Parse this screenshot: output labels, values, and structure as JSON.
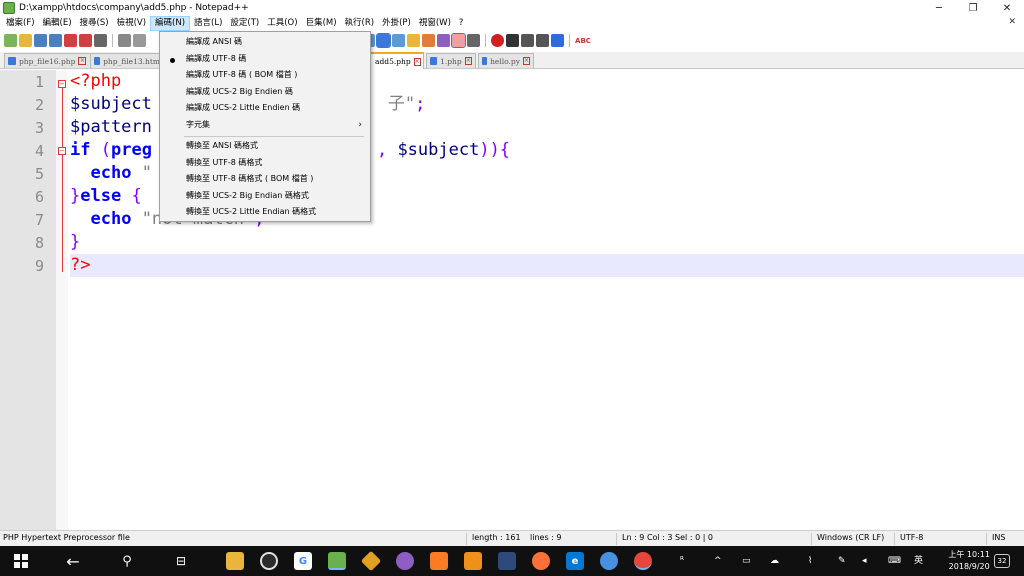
{
  "window": {
    "title": "D:\\xampp\\htdocs\\company\\add5.php - Notepad++",
    "minimize_glyph": "─",
    "maximize_glyph": "❐",
    "close_glyph": "✕"
  },
  "menubar": {
    "items": [
      "檔案(F)",
      "編輯(E)",
      "搜尋(S)",
      "檢視(V)",
      "編碼(N)",
      "語言(L)",
      "設定(T)",
      "工具(O)",
      "巨集(M)",
      "執行(R)",
      "外掛(P)",
      "視窗(W)",
      "?"
    ],
    "active_index": 4,
    "close_glyph": "✕"
  },
  "tabs": [
    {
      "label": "php_file16.php",
      "active": false
    },
    {
      "label": "php_file13.htm",
      "active": false
    },
    {
      "label": "add5.php",
      "active": true
    },
    {
      "label": "1.php",
      "active": false
    },
    {
      "label": "hello.py",
      "active": false
    }
  ],
  "editor": {
    "line_numbers": [
      "1",
      "2",
      "3",
      "4",
      "5",
      "6",
      "7",
      "8",
      "9"
    ],
    "current_line": 9,
    "fold_minus": "−"
  },
  "encoding_menu": {
    "items": [
      {
        "label": "編譯成 ANSI 碼",
        "checked": false
      },
      {
        "label": "編譯成 UTF-8 碼",
        "checked": true
      },
      {
        "label": "編譯成 UTF-8 碼 ( BOM 檔首 )",
        "checked": false
      },
      {
        "label": "編譯成 UCS-2 Big Endien 碼",
        "checked": false
      },
      {
        "label": "編譯成 UCS-2 Little Endien 碼",
        "checked": false
      },
      {
        "label": "字元集",
        "checked": false,
        "submenu": true
      },
      {
        "label": "轉換至 ANSI 碼格式",
        "checked": false
      },
      {
        "label": "轉換至 UTF-8 碼格式",
        "checked": false
      },
      {
        "label": "轉換至 UTF-8 碼格式 ( BOM 檔首 )",
        "checked": false
      },
      {
        "label": "轉換至 UCS-2 Big Endian 碼格式",
        "checked": false
      },
      {
        "label": "轉換至 UCS-2 Little Endian 碼格式",
        "checked": false
      }
    ],
    "submenu_arrow": "›"
  },
  "statusbar": {
    "language": "PHP Hypertext Preprocessor file",
    "length": "length : 161",
    "lines": "lines : 9",
    "position": "Ln : 9   Col : 3   Sel : 0 | 0",
    "eol": "Windows (CR LF)",
    "encoding": "UTF-8",
    "mode": "INS"
  },
  "taskbar": {
    "ime": "英",
    "time": "上午 10:11",
    "date": "2018/9/20",
    "notification_count": "32"
  },
  "colors": {
    "accent": "#f5a623",
    "menu_highlight": "#cce8ff",
    "current_line": "#e8e8ff",
    "keyword": "#0000ff",
    "php_tag": "#ff0000"
  }
}
